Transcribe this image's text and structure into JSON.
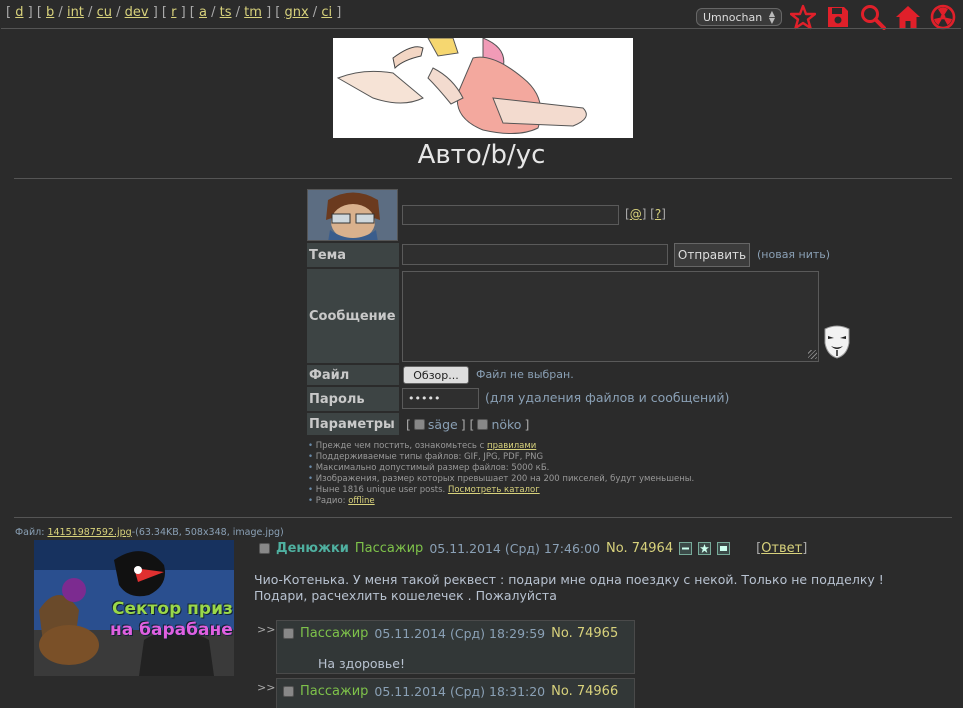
{
  "nav": {
    "groups": [
      [
        "d"
      ],
      [
        "b",
        "int",
        "cu",
        "dev"
      ],
      [
        "r"
      ],
      [
        "a",
        "ts",
        "tm"
      ],
      [
        "gnx",
        "ci"
      ]
    ]
  },
  "toolbar": {
    "board_select": "Umnochan",
    "icons": [
      "star-icon",
      "save-icon",
      "search-icon",
      "home-icon",
      "radiation-icon"
    ]
  },
  "board": {
    "title": "Авто/b/ус"
  },
  "form": {
    "at_link": "@",
    "help_link": "?",
    "subject_label": "Тема",
    "submit_label": "Отправить",
    "new_thread": "(новая нить)",
    "message_label": "Сообщение",
    "file_label": "Файл",
    "browse_label": "Обзор...",
    "no_file": "Файл не выбран.",
    "password_label": "Пароль",
    "password_value": "•••••",
    "password_hint": "(для удаления файлов и сообщений)",
    "options_label": "Параметры",
    "sage": "säge",
    "noko": "nöko"
  },
  "rules": {
    "r1_text": "Прежде чем постить, ознакомьтесь с ",
    "r1_link": "правилами",
    "r2": "Поддерживаемые типы файлов: GIF, JPG, PDF, PNG",
    "r3": "Максимально допустимый размер файлов: 5000 кБ.",
    "r4": "Изображения, размер которых превышает 200 на 200 пикселей, будут уменьшены.",
    "r5_text": "Ныне 1816 unique user posts. ",
    "r5_link": "Посмотреть каталог",
    "r6_text": "Радио: ",
    "r6_link": "offline"
  },
  "thread": {
    "file_prefix": "Файл: ",
    "file_name": "14151987592.jpg",
    "file_meta": "-(63.34KB, 508x348, image.jpg)",
    "thumb_caption_1": "Сектор приз",
    "thumb_caption_2": "на барабане",
    "subject": "Денюжки",
    "author": "Пассажир",
    "date": "05.11.2014 (Срд) 17:46:00",
    "number": "No. 74964",
    "reply_link": "Ответ",
    "text_line1": "Чио-Котенька. У меня такой реквест : подари мне одна поездку с некой. Только не подделку !",
    "text_line2": "Подари, расчехлить кошелечек . Пожалуйста"
  },
  "replies": [
    {
      "arrows": ">>",
      "author": "Пассажир",
      "date": "05.11.2014 (Срд) 18:29:59",
      "number": "No. 74965",
      "text": "На здоровье!"
    },
    {
      "arrows": ">>",
      "author": "Пассажир",
      "date": "05.11.2014 (Срд) 18:31:20",
      "number": "No. 74966",
      "text": ""
    }
  ],
  "colors": {
    "background": "#2b2b2b",
    "link": "#d8d27c",
    "subject": "#4fb0a0",
    "author": "#7ec24a",
    "accent_red": "#e0202a"
  }
}
